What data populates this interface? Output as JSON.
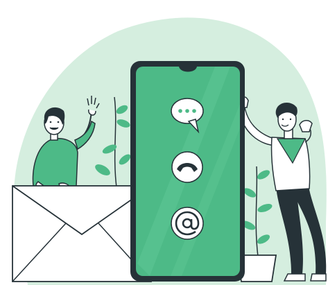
{
  "palette": {
    "accent": "#4DBA87",
    "accent_dark": "#3FA775",
    "background_blob": "#D5EEDF",
    "outline": "#263238",
    "phone_body": "#263238",
    "white": "#FFFFFF"
  },
  "icons": [
    "chat-bubble-icon",
    "phone-handset-icon",
    "at-sign-icon"
  ],
  "people": [
    "woman-waving",
    "man-phone-gesture"
  ],
  "objects": [
    "envelope",
    "smartphone",
    "potted-plant-left",
    "potted-plant-right"
  ]
}
